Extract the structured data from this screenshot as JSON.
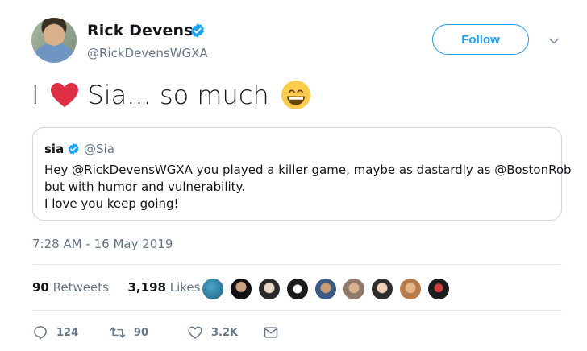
{
  "author": {
    "name": "Rick Devens",
    "handle": "@RickDevensWGXA",
    "verified": true,
    "avatar_icon": "profile-photo"
  },
  "follow_label": "Follow",
  "tweet": {
    "text_before_heart": "I",
    "text_after_heart": "Sia... so much",
    "emoji": [
      "red-heart-icon",
      "grinning-face-icon"
    ]
  },
  "quoted_tweet": {
    "name": "sia",
    "handle": "@Sia",
    "verified": true,
    "lines": [
      "Hey @RickDevensWGXA you played a killer game, maybe as dastardly as @BostonRob",
      "but with humor and vulnerability.",
      "I love you keep going!"
    ]
  },
  "timestamp": "7:28 AM - 16 May 2019",
  "stats": {
    "retweets_count": "90",
    "retweets_label": "Retweets",
    "likes_count": "3,198",
    "likes_label": "Likes"
  },
  "likers_count_shown": 9,
  "actions": {
    "reply_count": "124",
    "retweet_count": "90",
    "like_count": "3.2K"
  },
  "colors": {
    "accent": "#1da1f2",
    "heart": "#e0245e",
    "secondary_text": "#657786",
    "border": "#ccd6dd"
  }
}
